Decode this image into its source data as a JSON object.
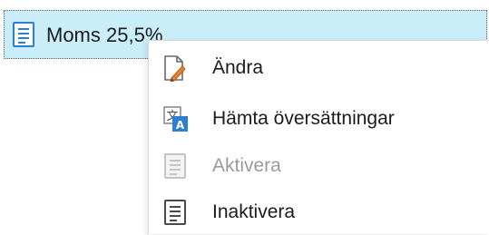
{
  "tree": {
    "selected_item": {
      "label": "Moms 25,5%",
      "icon": "list-document-icon"
    }
  },
  "context_menu": {
    "items": [
      {
        "label": "Ändra",
        "icon": "edit-document-icon",
        "enabled": true
      },
      {
        "label": "Hämta översättningar",
        "icon": "translate-icon",
        "enabled": true
      },
      {
        "label": "Aktivera",
        "icon": "list-document-icon",
        "enabled": false
      },
      {
        "label": "Inaktivera",
        "icon": "list-document-icon",
        "enabled": true
      }
    ]
  },
  "colors": {
    "selection_background": "#c9eefa",
    "icon_blue": "#2e7fd2",
    "disabled_text": "#9a9a9a",
    "edit_pencil": "#e7832c"
  }
}
